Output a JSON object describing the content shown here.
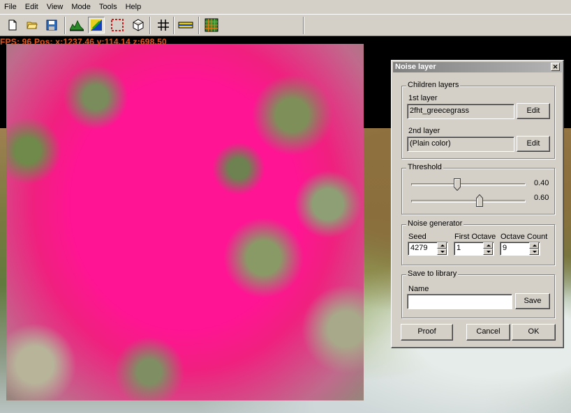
{
  "menu": [
    "File",
    "Edit",
    "View",
    "Mode",
    "Tools",
    "Help"
  ],
  "toolbar": {
    "buttons": [
      "new-file-icon",
      "open-folder-icon",
      "save-disk-icon",
      "terrain-icon",
      "layer-paint-icon",
      "selection-icon",
      "cube-icon",
      "grid-icon",
      "level-icon",
      "texture-grid-icon"
    ]
  },
  "hud": {
    "text": "FPS: 96   Pos: x:1237.46  y:114.14  z:698.50"
  },
  "dialog": {
    "title": "Noise layer",
    "close_symbol": "✕",
    "children": {
      "title": "Children layers",
      "first_label": "1st layer",
      "first_value": "2fht_greecegrass",
      "first_edit": "Edit",
      "second_label": "2nd layer",
      "second_value": "(Plain color)",
      "second_edit": "Edit"
    },
    "threshold": {
      "title": "Threshold",
      "low": 0.4,
      "high": 0.6,
      "low_text": "0.40",
      "high_text": "0.60"
    },
    "noise": {
      "title": "Noise generator",
      "seed_label": "Seed",
      "seed_value": "4279",
      "first_octave_label": "First Octave",
      "first_octave_value": "1",
      "octave_count_label": "Octave Count",
      "octave_count_value": "9"
    },
    "save": {
      "title": "Save to library",
      "name_label": "Name",
      "name_value": "",
      "save_button": "Save"
    },
    "buttons": {
      "proof": "Proof",
      "cancel": "Cancel",
      "ok": "OK"
    }
  }
}
